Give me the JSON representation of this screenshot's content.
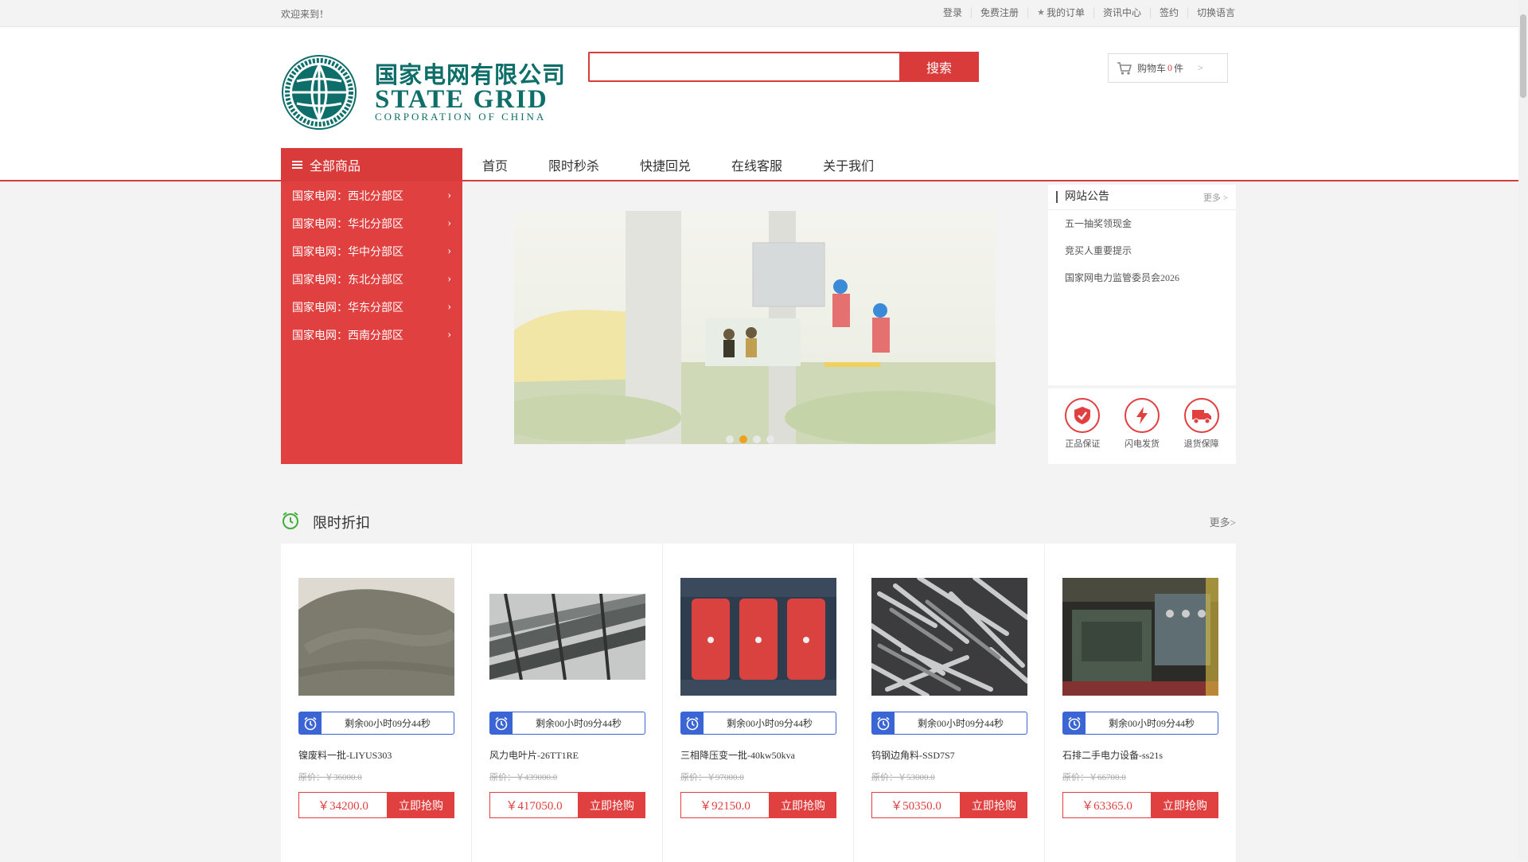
{
  "topbar": {
    "welcome": "欢迎来到！",
    "links": [
      "登录",
      "免费注册",
      "我的订单",
      "资讯中心",
      "签约",
      "切换语言"
    ]
  },
  "logo": {
    "cn": "国家电网有限公司",
    "en1": "STATE GRID",
    "en2": "CORPORATION OF CHINA"
  },
  "search": {
    "placeholder": "",
    "value": "",
    "button": "搜索"
  },
  "cart": {
    "label": "购物车",
    "count": "0",
    "unit": "件",
    "arrow": ">"
  },
  "nav": {
    "all_label": "全部商品",
    "links": [
      "首页",
      "限时秒杀",
      "快捷回兑",
      "在线客服",
      "关于我们"
    ]
  },
  "categories": [
    "国家电网：西北分部区",
    "国家电网：华北分部区",
    "国家电网：华中分部区",
    "国家电网：东北分部区",
    "国家电网：华东分部区",
    "国家电网：西南分部区"
  ],
  "banner": {
    "active_dot": 2,
    "dot_count": 4
  },
  "notice": {
    "title": "网站公告",
    "more": "更多 >",
    "items": [
      "五一抽奖领现金",
      "竞买人重要提示",
      "国家网电力监管委员会2026"
    ]
  },
  "guarantees": [
    "正品保证",
    "闪电发货",
    "退货保障"
  ],
  "discount": {
    "title": "限时折扣",
    "more": "更多>",
    "products": [
      {
        "timer": "剩余00小时09分44秒",
        "name": "镍废料一批-LIYUS303",
        "orig": "原价：￥36000.0",
        "price": "￥34200.0",
        "buy": "立即抢购",
        "img": "gravel"
      },
      {
        "timer": "剩余00小时09分44秒",
        "name": "风力电叶片-26TT1RE",
        "orig": "原价：￥439000.0",
        "price": "￥417050.0",
        "buy": "立即抢购",
        "img": "blades"
      },
      {
        "timer": "剩余00小时09分44秒",
        "name": "三相降压变一批-40kw50kva",
        "orig": "原价：￥97000.0",
        "price": "￥92150.0",
        "buy": "立即抢购",
        "img": "transformer"
      },
      {
        "timer": "剩余00小时09分44秒",
        "name": "钨钢边角料-SSD7S7",
        "orig": "原价：￥53000.0",
        "price": "￥50350.0",
        "buy": "立即抢购",
        "img": "scrap"
      },
      {
        "timer": "剩余00小时09分44秒",
        "name": "石排二手电力设备-ss21s",
        "orig": "原价：￥66700.0",
        "price": "￥63365.0",
        "buy": "立即抢购",
        "img": "generator"
      }
    ]
  },
  "colors": {
    "brand_red": "#d93a3a",
    "logo_green": "#0d6e6a",
    "timer_blue": "#3b64d4"
  }
}
